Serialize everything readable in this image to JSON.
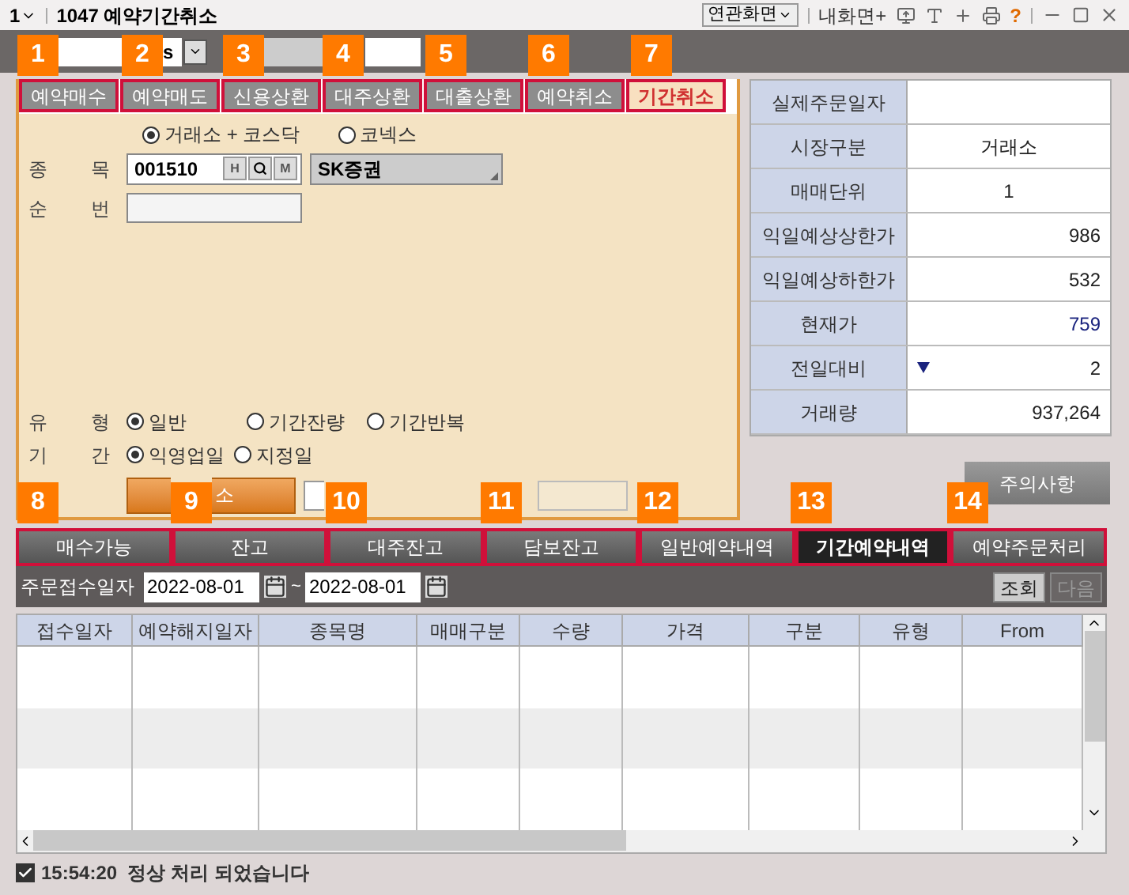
{
  "title_bar": {
    "screen_menu": "1",
    "title": "1047 예약기간취소",
    "related": "연관화면",
    "my_screen": "내화면+",
    "help": "?"
  },
  "toolbar": {
    "field_text": "s"
  },
  "order_tabs": [
    {
      "label": "예약매수",
      "selected": false
    },
    {
      "label": "예약매도",
      "selected": false
    },
    {
      "label": "신용상환",
      "selected": false
    },
    {
      "label": "대주상환",
      "selected": false
    },
    {
      "label": "대출상환",
      "selected": false
    },
    {
      "label": "예약취소",
      "selected": false
    },
    {
      "label": "기간취소",
      "selected": true
    }
  ],
  "form": {
    "market_options": [
      {
        "label": "거래소 + 코스닥",
        "selected": true
      },
      {
        "label": "코넥스",
        "selected": false
      }
    ],
    "stock_label": "종 목",
    "stock_code": "001510",
    "code_buttons": [
      "H",
      "M"
    ],
    "stock_name": "SK증권",
    "seq_label": "순 번",
    "type_label": "유 형",
    "type_options": [
      {
        "label": "일반",
        "selected": true
      },
      {
        "label": "기간잔량",
        "selected": false
      },
      {
        "label": "기간반복",
        "selected": false
      }
    ],
    "period_label": "기 간",
    "period_options": [
      {
        "label": "익영업일",
        "selected": true
      },
      {
        "label": "지정일",
        "selected": false
      }
    ],
    "submit_button": "소"
  },
  "info_table": [
    {
      "label": "실제주문일자",
      "kind": "number"
    },
    {
      "label": "시장구분",
      "value": "거래소",
      "kind": "text"
    },
    {
      "label": "매매단위",
      "value": "1",
      "kind": "text"
    },
    {
      "label": "익일예상상한가",
      "value": "986",
      "kind": "number"
    },
    {
      "label": "익일예상하한가",
      "value": "532",
      "kind": "number"
    },
    {
      "label": "현재가",
      "value": "759",
      "kind": "number",
      "color": "#1a237e"
    },
    {
      "label": "전일대비",
      "value": "2",
      "kind": "number",
      "down": true
    },
    {
      "label": "거래량",
      "value": "937,264",
      "kind": "number"
    }
  ],
  "notice_button": "주의사항",
  "bottom_tabs": [
    {
      "label": "매수가능",
      "selected": false
    },
    {
      "label": "잔고",
      "selected": false
    },
    {
      "label": "대주잔고",
      "selected": false
    },
    {
      "label": "담보잔고",
      "selected": false
    },
    {
      "label": "일반예약내역",
      "selected": false
    },
    {
      "label": "기간예약내역",
      "selected": true
    },
    {
      "label": "예약주문처리",
      "selected": false
    }
  ],
  "filter": {
    "label": "주문접수일자",
    "from": "2022-08-01",
    "separator": "~",
    "to": "2022-08-01",
    "buttons": [
      {
        "label": "조회",
        "disabled": false
      },
      {
        "label": "다음",
        "disabled": true
      }
    ]
  },
  "grid": {
    "columns": [
      "접수일자",
      "예약해지일자",
      "종목명",
      "매매구분",
      "수량",
      "가격",
      "구분",
      "유형",
      "From"
    ]
  },
  "status_bar": {
    "checked": true,
    "message": "15:54:20  정상 처리 되었습니다"
  },
  "badges": [
    "1",
    "2",
    "3",
    "4",
    "5",
    "6",
    "7",
    "8",
    "9",
    "10",
    "11",
    "12",
    "13",
    "14"
  ]
}
